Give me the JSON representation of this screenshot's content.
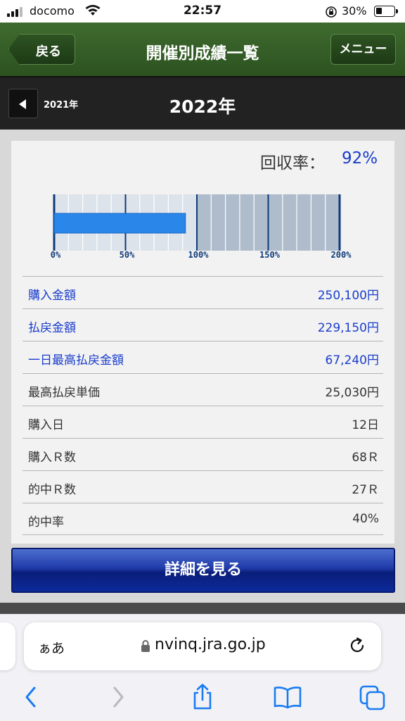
{
  "status_bar": {
    "carrier": "docomo",
    "time": "22:57",
    "battery": "30%"
  },
  "header": {
    "back_label": "戻る",
    "title": "開催別成績一覧",
    "menu_label": "メニュー"
  },
  "year_nav": {
    "prev_year": "2021年",
    "current_year": "2022年"
  },
  "summary": {
    "recovery_label": "回収率：",
    "recovery_value": "92%",
    "recovery_ratio": 0.92,
    "gauge_ticks": [
      "0%",
      "50%",
      "100%",
      "150%",
      "200%"
    ],
    "gauge_colors": {
      "filled": "#2a86e8",
      "track_low": "#dde3ea",
      "track_high": "#aebccb",
      "major_line": "#0f3a7a"
    }
  },
  "stats": [
    {
      "label": "購入金額",
      "value": "250,100円",
      "link": true
    },
    {
      "label": "払戻金額",
      "value": "229,150円",
      "link": true
    },
    {
      "label": "一日最高払戻金額",
      "value": "67,240円",
      "link": true
    },
    {
      "label": "最高払戻単価",
      "value": "25,030円",
      "link": false
    },
    {
      "label": "購入日",
      "value": "12日",
      "link": false
    },
    {
      "label": "購入Ｒ数",
      "value": "68Ｒ",
      "link": false
    },
    {
      "label": "的中Ｒ数",
      "value": "27Ｒ",
      "link": false
    },
    {
      "label": "的中率",
      "value": "40%",
      "link": false
    }
  ],
  "detail_button": "詳細を見る",
  "browser": {
    "text_size": "ぁあ",
    "url": "nvinq.jra.go.jp",
    "icons": [
      "back-icon",
      "forward-icon",
      "share-icon",
      "bookmarks-icon",
      "tabs-icon"
    ]
  },
  "colors": {
    "header_green": "#2f5a23",
    "link_blue": "#1a3ccc",
    "button_blue": "#1f3aa8"
  }
}
